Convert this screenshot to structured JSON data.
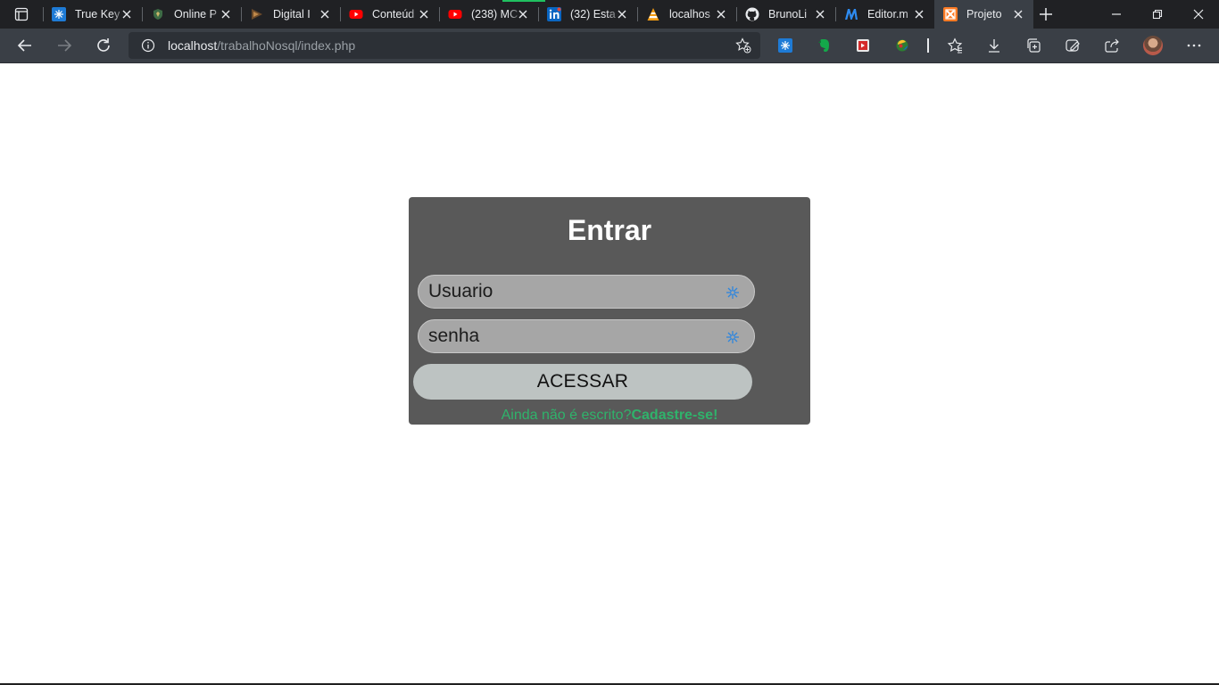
{
  "browser": {
    "tabs": [
      {
        "title": "True Key",
        "icon": "truekey-icon"
      },
      {
        "title": "Online P",
        "icon": "shield-logo-icon"
      },
      {
        "title": "Digital I",
        "icon": "digital-logo-icon"
      },
      {
        "title": "Conteúd",
        "icon": "youtube-icon"
      },
      {
        "title": "(238) MC",
        "icon": "youtube-icon"
      },
      {
        "title": "(32) Esta",
        "icon": "linkedin-icon"
      },
      {
        "title": "localhos",
        "icon": "xampp-cone-icon"
      },
      {
        "title": "BrunoLi",
        "icon": "github-icon"
      },
      {
        "title": "Editor.m",
        "icon": "markdown-editor-icon"
      },
      {
        "title": "Projeto",
        "icon": "xampp-icon",
        "active": true
      }
    ],
    "address": {
      "host": "localhost",
      "path": "/trabalhoNosql/index.php"
    },
    "colors": {
      "tabstrip": "#202124",
      "toolbar": "#3a3f46",
      "youtube": "#ff0000",
      "linkedin": "#0a66c2",
      "xampp": "#fb7a24"
    }
  },
  "page": {
    "title": "Entrar",
    "username": {
      "value": "",
      "placeholder": "Usuario"
    },
    "password": {
      "value": "",
      "placeholder": "senha"
    },
    "submit_label": "ACESSAR",
    "signup_prompt": "Ainda não é escrito?",
    "signup_link": "Cadastre-se!",
    "colors": {
      "panel": "#595959",
      "field": "#a6a6a6",
      "button": "#bdc3c2",
      "link": "#2fb36b"
    }
  }
}
